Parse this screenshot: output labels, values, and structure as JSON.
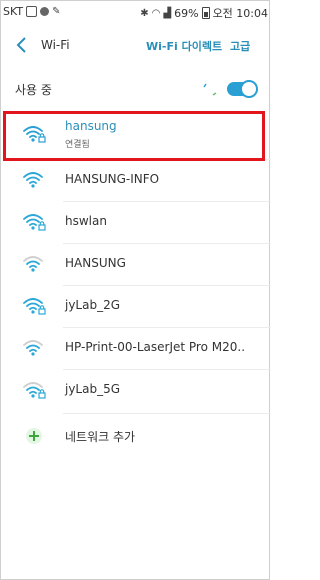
{
  "status_bar": {
    "carrier": "SKT",
    "battery": "69%",
    "time": "오전 10:04"
  },
  "header": {
    "title": "Wi-Fi",
    "wifi_direct_label": "Wi-Fi 다이렉트",
    "advanced_label": "고급"
  },
  "in_use": {
    "label": "사용 중",
    "enabled": true
  },
  "networks": [
    {
      "name": "hansung",
      "status": "연결됨",
      "secured": true,
      "active": true
    },
    {
      "name": "HANSUNG-INFO",
      "status": "",
      "secured": false,
      "active": false
    },
    {
      "name": "hswlan",
      "status": "",
      "secured": true,
      "active": false
    },
    {
      "name": "HANSUNG",
      "status": "",
      "secured": false,
      "active": false
    },
    {
      "name": "jyLab_2G",
      "status": "",
      "secured": true,
      "active": false
    },
    {
      "name": "HP-Print-00-LaserJet Pro M20..",
      "status": "",
      "secured": false,
      "active": false
    },
    {
      "name": "jyLab_5G",
      "status": "",
      "secured": true,
      "active": false
    }
  ],
  "add_network_label": "네트워크 추가",
  "colors": {
    "accent": "#2a8fb8",
    "toggle": "#2a9fd4",
    "highlight": "#e2141c"
  }
}
